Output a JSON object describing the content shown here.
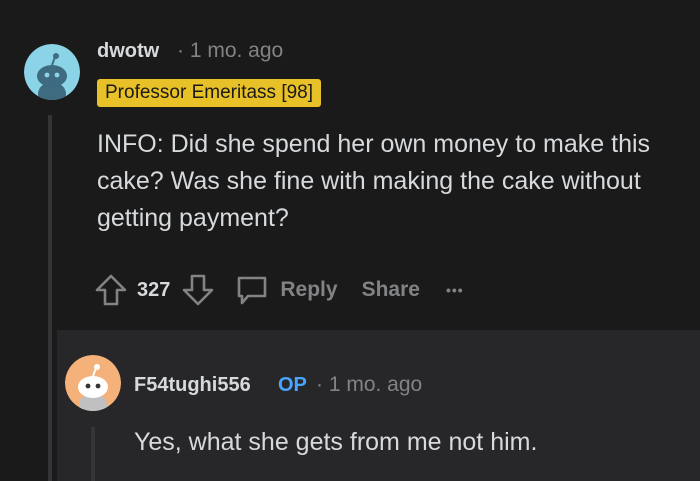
{
  "colors": {
    "background": "#1a1a1b",
    "reply_background": "#272729",
    "flair_background": "#e8c028",
    "op_badge": "#4aa3ff",
    "text_primary": "#d7dadc",
    "text_muted": "#818384"
  },
  "comment": {
    "username": "dwotw",
    "timestamp": "· 1 mo. ago",
    "flair": "Professor Emeritass [98]",
    "avatar_icon": "snoo-avatar-icon",
    "body": "INFO: Did she spend her own money to make this cake? Was she fine with making the cake without getting payment?",
    "votes": "327",
    "reply_label": "Reply",
    "share_label": "Share",
    "more_label": "•••"
  },
  "reply": {
    "username": "F54tughi556",
    "op_badge": "OP",
    "timestamp": "· 1 mo. ago",
    "avatar_icon": "snoo-avatar-icon",
    "body": "Yes, what she gets from me not him."
  }
}
